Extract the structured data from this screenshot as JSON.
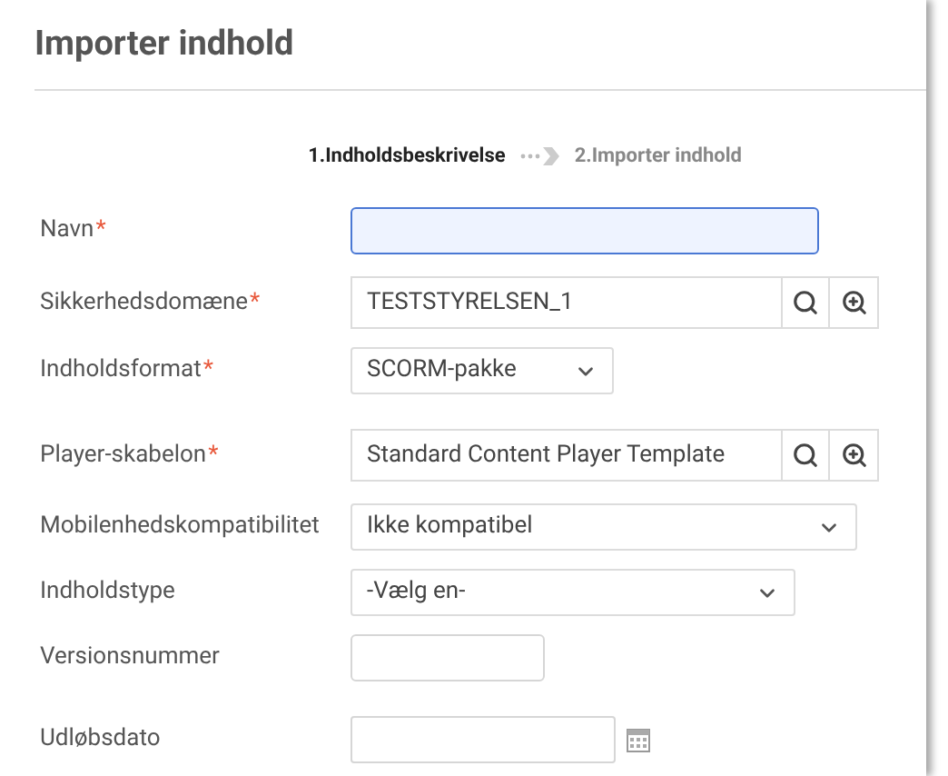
{
  "title": "Importer indhold",
  "steps": [
    {
      "label": "1.Indholdsbeskrivelse",
      "selected": true
    },
    {
      "label": "2.Importer indhold",
      "selected": false
    }
  ],
  "fields": [
    {
      "kind": "text",
      "label": "Navn",
      "required_mark": "*",
      "focused": true
    },
    {
      "kind": "lookup",
      "label": "Sikkerhedsdomæne",
      "required_mark": "*",
      "value": "TESTSTYRELSEN_1"
    },
    {
      "kind": "select",
      "label": "Indholdsformat",
      "required_mark": "*",
      "value": "SCORM-pakke"
    },
    {
      "kind": "lookup",
      "label": "Player-skabelon",
      "required_mark": "*",
      "value": "Standard Content Player Template"
    },
    {
      "kind": "select",
      "label": "Mobilenhedskompatibilitet",
      "value": "Ikke kompatibel"
    },
    {
      "kind": "select",
      "label": "Indholdstype",
      "value": "-Vælg en-"
    },
    {
      "kind": "text",
      "label": "Versionsnummer",
      "focused": false
    },
    {
      "kind": "date",
      "label": "Udløbsdato"
    }
  ]
}
